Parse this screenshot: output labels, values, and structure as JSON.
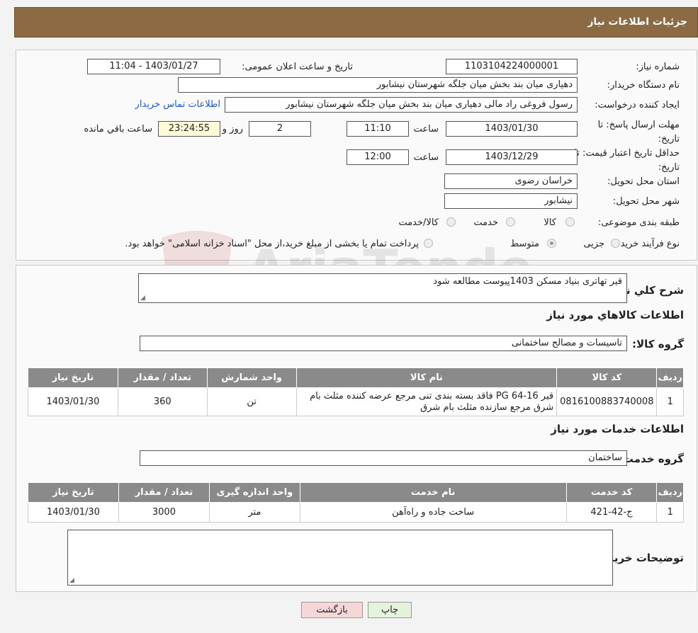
{
  "header": {
    "title": "جزئیات اطلاعات نیاز"
  },
  "info": {
    "need_number_label": "شماره نیاز:",
    "need_number": "1103104224000001",
    "announce_label": "تاریخ و ساعت اعلان عمومی:",
    "announce_value": "1403/01/27 - 11:04",
    "buyer_org_label": "نام دستگاه خریدار:",
    "buyer_org": "دهیاری میان بند بخش میان جلگه شهرستان نیشابور",
    "creator_label": "ایجاد کننده درخواست:",
    "creator": "رسول فروغی راد مالی دهیاری میان بند بخش میان جلگه شهرستان نیشابور",
    "contact_link": "اطلاعات تماس خریدار",
    "deadline_label": "مهلت ارسال پاسخ: تا تاریخ:",
    "deadline_date": "1403/01/30",
    "time_label": "ساعت",
    "deadline_time": "11:10",
    "days_value": "2",
    "days_label": "روز و",
    "remaining_time": "23:24:55",
    "remaining_label": "ساعت باقي مانده",
    "validity_label": "حداقل تاریخ اعتبار قیمت: تا تاریخ:",
    "validity_date": "1403/12/29",
    "validity_time": "12:00",
    "province_label": "استان محل تحویل:",
    "province": "خراسان رضوی",
    "city_label": "شهر محل تحویل:",
    "city": "نیشابور",
    "category_label": "طبقه بندی موضوعی:",
    "category_options": [
      "کالا",
      "خدمت",
      "کالا/خدمت"
    ],
    "process_label": "نوع فرآیند خرید :",
    "process_options": [
      "جزیی",
      "متوسط"
    ],
    "process_note": "پرداخت تمام یا بخشی از مبلغ خرید،از محل \"اسناد خزانه اسلامی\" خواهد بود."
  },
  "watermark": {
    "text": "AriaTender.neT"
  },
  "description": {
    "label": "شرح کلي نياز:",
    "value": "قیر تهاتری بنیاد مسکن 1403پیوست مطالعه شود"
  },
  "goods": {
    "section_title": "اطلاعات کالاهاي مورد نياز",
    "group_label": "گروه کالا:",
    "group_value": "تاسیسات و مصالح ساختمانی",
    "headers": [
      "رديف",
      "کد کالا",
      "نام کالا",
      "واحد شمارش",
      "تعداد / مقدار",
      "تاريخ نياز"
    ],
    "rows": [
      {
        "index": "1",
        "code": "0816100883740008",
        "name": "قیر 16-64 PG فاقد بسته بندی تنی مرجع عرضه کننده مثلث بام شرق مرجع سازنده مثلث بام شرق",
        "unit": "تن",
        "qty": "360",
        "date": "1403/01/30"
      }
    ]
  },
  "services": {
    "section_title": "اطلاعات خدمات مورد نياز",
    "group_label": "گروه خدمت:",
    "group_value": "ساختمان",
    "headers": [
      "رديف",
      "کد خدمت",
      "نام خدمت",
      "واحد اندازه گيری",
      "تعداد / مقدار",
      "تاريخ نياز"
    ],
    "rows": [
      {
        "index": "1",
        "code": "ج-42-421",
        "name": "ساخت جاده و راه‌آهن",
        "unit": "متر",
        "qty": "3000",
        "date": "1403/01/30"
      }
    ]
  },
  "buyer_notes": {
    "label": "توضيحات خريدار:",
    "value": ""
  },
  "actions": {
    "print": "چاپ",
    "back": "بازگشت"
  },
  "colors": {
    "header_bg": "#8b6a44",
    "table_header_bg": "#8a8a8a",
    "link": "#1a5ad6",
    "back_button": "#f6d6d6",
    "print_button": "#e4f4dc",
    "remaining_bg": "#fffbd9"
  }
}
